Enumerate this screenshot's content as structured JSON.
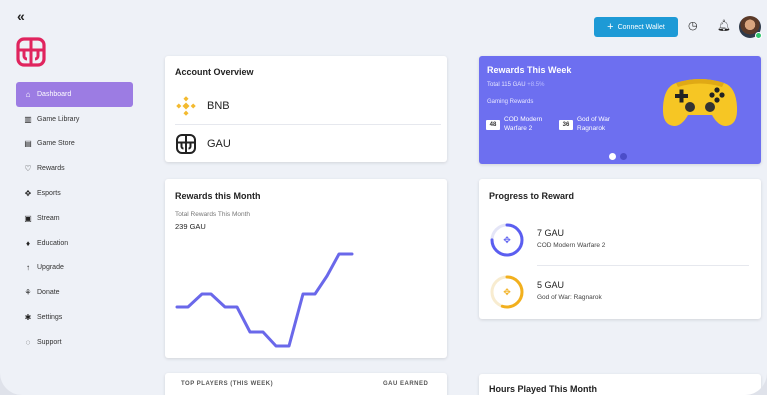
{
  "nav": {
    "collapse_icon": "chevrons-left-icon",
    "items": [
      {
        "label": "Dashboard",
        "icon": "home-icon",
        "glyph": "⌂"
      },
      {
        "label": "Game Library",
        "icon": "library-icon",
        "glyph": "▥"
      },
      {
        "label": "Game Store",
        "icon": "store-icon",
        "glyph": "▤"
      },
      {
        "label": "Rewards",
        "icon": "heart-icon",
        "glyph": "♡"
      },
      {
        "label": "Esports",
        "icon": "gamepad-icon",
        "glyph": "✥"
      },
      {
        "label": "Stream",
        "icon": "screen-icon",
        "glyph": "▣"
      },
      {
        "label": "Education",
        "icon": "graduation-cap-icon",
        "glyph": "♦"
      },
      {
        "label": "Upgrade",
        "icon": "arrow-up-icon",
        "glyph": "↑"
      },
      {
        "label": "Donate",
        "icon": "donate-icon",
        "glyph": "⚘"
      },
      {
        "label": "Settings",
        "icon": "gear-icon",
        "glyph": "✱"
      },
      {
        "label": "Support",
        "icon": "support-icon",
        "glyph": "◌"
      }
    ],
    "active_index": 0
  },
  "topbar": {
    "connect_wallet_label": "Connect Wallet",
    "history_icon": "clock-icon",
    "notification_icon": "bell-icon"
  },
  "account_overview": {
    "title": "Account Overview",
    "rows": [
      {
        "label": "BNB",
        "icon": "bnb-coin-icon"
      },
      {
        "label": "GAU",
        "icon": "gau-coin-icon"
      }
    ]
  },
  "rewards_week": {
    "title": "Rewards This Week",
    "total": "Total 115 GAU",
    "total_change": "+8.5%",
    "section_label": "Gaming Rewards",
    "games": [
      {
        "badge": "48",
        "name": "COD Modern Warfare 2"
      },
      {
        "badge": "36",
        "name": "God of War Ragnarok"
      }
    ],
    "carousel_active": 0
  },
  "rewards_month": {
    "title": "Rewards this Month",
    "sub_label": "Total Rewards This Month",
    "value": "239 GAU"
  },
  "progress": {
    "title": "Progress to Reward",
    "items": [
      {
        "amount": "7 GAU",
        "game": "COD Modern Warfare 2",
        "progress": 0.75,
        "color": "#5b5ef0"
      },
      {
        "amount": "5 GAU",
        "game": "God of War: Ragnarok",
        "progress": 0.55,
        "color": "#f2b01e"
      }
    ]
  },
  "top_players": {
    "col_players": "TOP PLAYERS (THIS WEEK)",
    "col_earned": "GAU EARNED"
  },
  "hours_played": {
    "title": "Hours Played This Month"
  },
  "colors": {
    "accent": "#9c7ce3",
    "button": "#1d9ad6",
    "banner": "#6d6ff0",
    "line": "#6a68ea"
  }
}
